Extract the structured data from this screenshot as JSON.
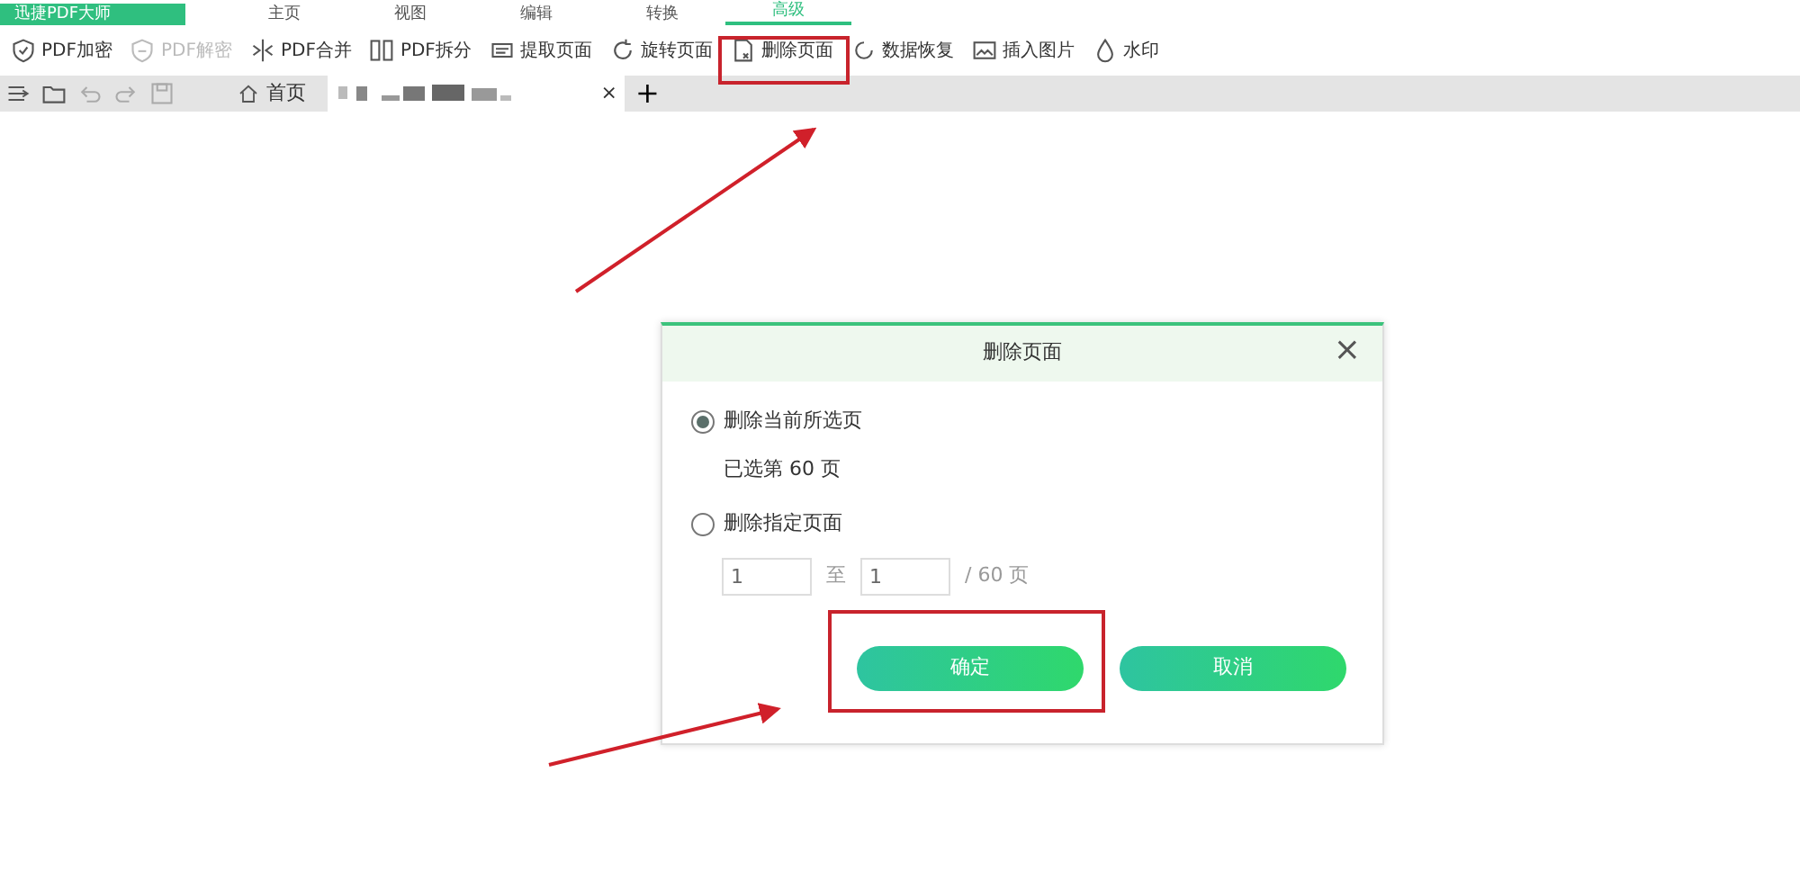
{
  "app": {
    "title": "迅捷PDF大师"
  },
  "ribbon_tabs": [
    {
      "label": "主页",
      "selected": false
    },
    {
      "label": "视图",
      "selected": false
    },
    {
      "label": "编辑",
      "selected": false
    },
    {
      "label": "转换",
      "selected": false
    },
    {
      "label": "高级",
      "selected": true
    }
  ],
  "toolbar": [
    {
      "label": "PDF加密",
      "disabled": false
    },
    {
      "label": "PDF解密",
      "disabled": true
    },
    {
      "label": "PDF合并",
      "disabled": false
    },
    {
      "label": "PDF拆分",
      "disabled": false
    },
    {
      "label": "提取页面",
      "disabled": false
    },
    {
      "label": "旋转页面",
      "disabled": false
    },
    {
      "label": "删除页面",
      "disabled": false
    },
    {
      "label": "数据恢复",
      "disabled": false
    },
    {
      "label": "插入图片",
      "disabled": false
    },
    {
      "label": "水印",
      "disabled": false
    }
  ],
  "quick_access": [
    {
      "disabled": false
    },
    {
      "disabled": false
    },
    {
      "disabled": true
    },
    {
      "disabled": true
    },
    {
      "disabled": true
    }
  ],
  "doc_tabs": [
    {
      "label": "首页",
      "selected": false
    },
    {
      "kind": "redacted",
      "selected": true,
      "close": "×"
    }
  ],
  "new_tab": "+",
  "dialog": {
    "title": "删除页面",
    "close": "×",
    "options": [
      {
        "label": "删除当前所选页",
        "selected": true,
        "note": "已选第 60 页"
      },
      {
        "label": "删除指定页面",
        "selected": false
      }
    ],
    "range": {
      "from": "1",
      "to_label": "至",
      "to": "1",
      "total": "/ 60 页"
    },
    "buttons": [
      "确定",
      "取消"
    ]
  }
}
